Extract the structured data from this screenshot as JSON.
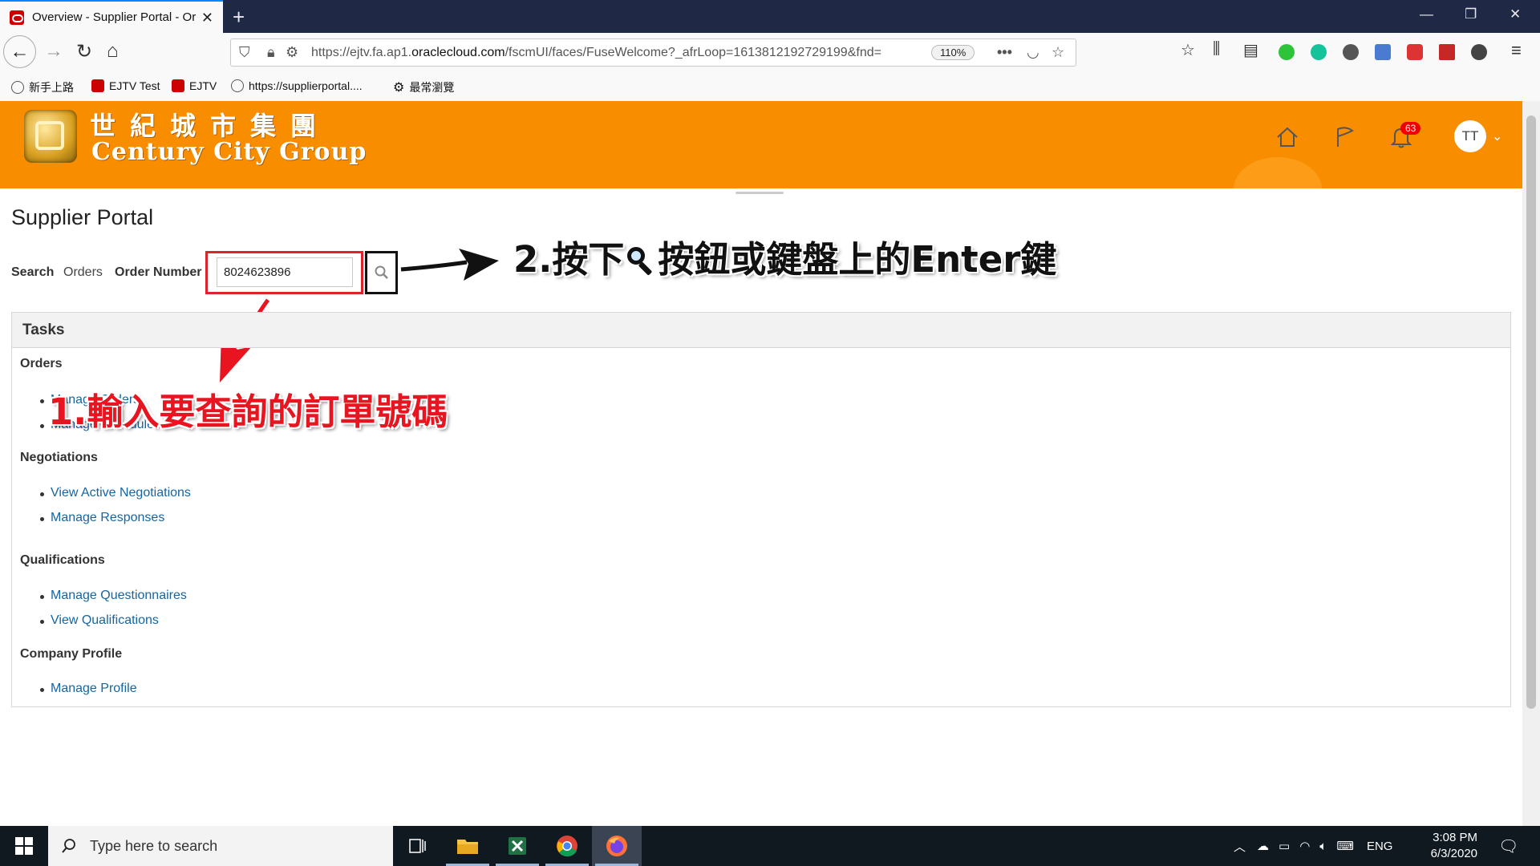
{
  "browser": {
    "tab_title": "Overview - Supplier Portal - Or",
    "url_host_prefix": "https://ejtv.fa.ap1.",
    "url_host_main": "oraclecloud.com",
    "url_path": "/fscmUI/faces/FuseWelcome?_afrLoop=1613812192729199&fnd=",
    "zoom": "110%",
    "bookmarks": [
      "新手上路",
      "EJTV Test",
      "EJTV",
      "https://supplierportal....",
      "最常瀏覽"
    ]
  },
  "header": {
    "logo_cn": "世紀城市集團",
    "logo_en": "Century City Group",
    "notification_count": "63",
    "avatar_initials": "TT",
    "color": "#f88d00"
  },
  "page": {
    "title": "Supplier Portal",
    "search_label": "Search",
    "search_scope": "Orders",
    "field_label": "Order Number",
    "order_number": "8024623896"
  },
  "tasks": {
    "heading": "Tasks",
    "orders": {
      "title": "Orders",
      "links": [
        "Manage Orders",
        "Manage Schedules"
      ]
    },
    "negotiations": {
      "title": "Negotiations",
      "links": [
        "View Active Negotiations",
        "Manage Responses"
      ]
    },
    "qualifications": {
      "title": "Qualifications",
      "links": [
        "Manage Questionnaires",
        "View Qualifications"
      ]
    },
    "company_profile": {
      "title": "Company Profile",
      "links": [
        "Manage Profile"
      ]
    }
  },
  "annotations": {
    "step1": "1.輸入要查詢的訂單號碼",
    "step2_before": "2.按下",
    "step2_after": "按鈕或鍵盤上的Enter鍵"
  },
  "taskbar": {
    "search_placeholder": "Type here to search",
    "language": "ENG",
    "time": "3:08 PM",
    "date": "6/3/2020"
  }
}
